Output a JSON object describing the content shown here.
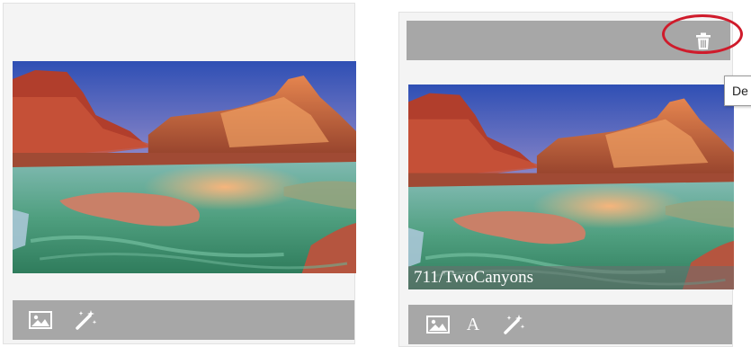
{
  "left_card": {
    "toolbar": {
      "image_icon": "image-icon",
      "magic_icon": "magic-wand-icon"
    }
  },
  "right_card": {
    "delete_icon": "trash-icon",
    "tooltip": "De",
    "caption": "711/TwoCanyons",
    "toolbar": {
      "image_icon": "image-icon",
      "text_label": "A",
      "magic_icon": "magic-wand-icon"
    }
  },
  "colors": {
    "bar": "#a7a7a7",
    "highlight": "#cf1b2b",
    "card_bg": "#f4f4f4"
  }
}
